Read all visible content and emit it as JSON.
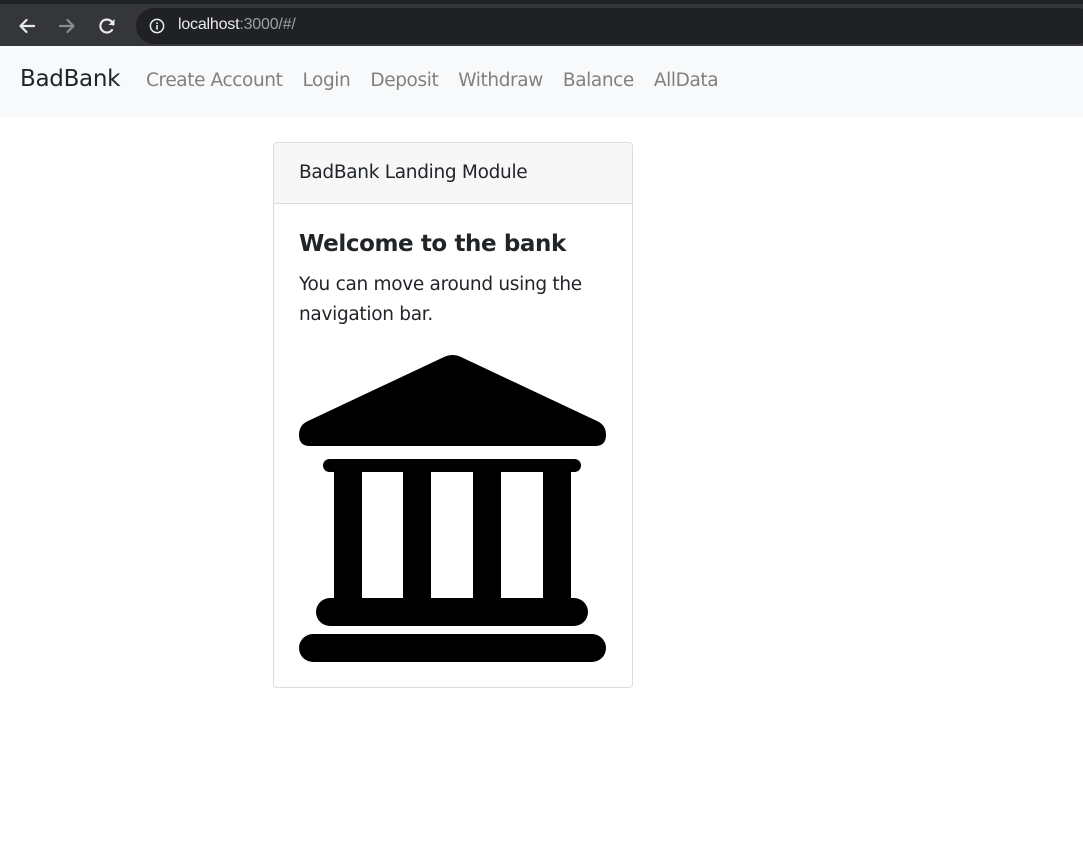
{
  "browser": {
    "url_host": "localhost",
    "url_rest": ":3000/#/"
  },
  "navbar": {
    "brand": "BadBank",
    "links": [
      "Create Account",
      "Login",
      "Deposit",
      "Withdraw",
      "Balance",
      "AllData"
    ]
  },
  "card": {
    "header": "BadBank Landing Module",
    "title": "Welcome to the bank",
    "text": "You can move around using the navigation bar.",
    "icon": "bank-icon"
  },
  "colors": {
    "chrome_bg": "#35363a",
    "address_bg": "#202124",
    "navbar_bg": "#f8f9fa",
    "nav_link": "#808080",
    "card_header_bg": "#f7f7f7",
    "text": "#212529"
  }
}
